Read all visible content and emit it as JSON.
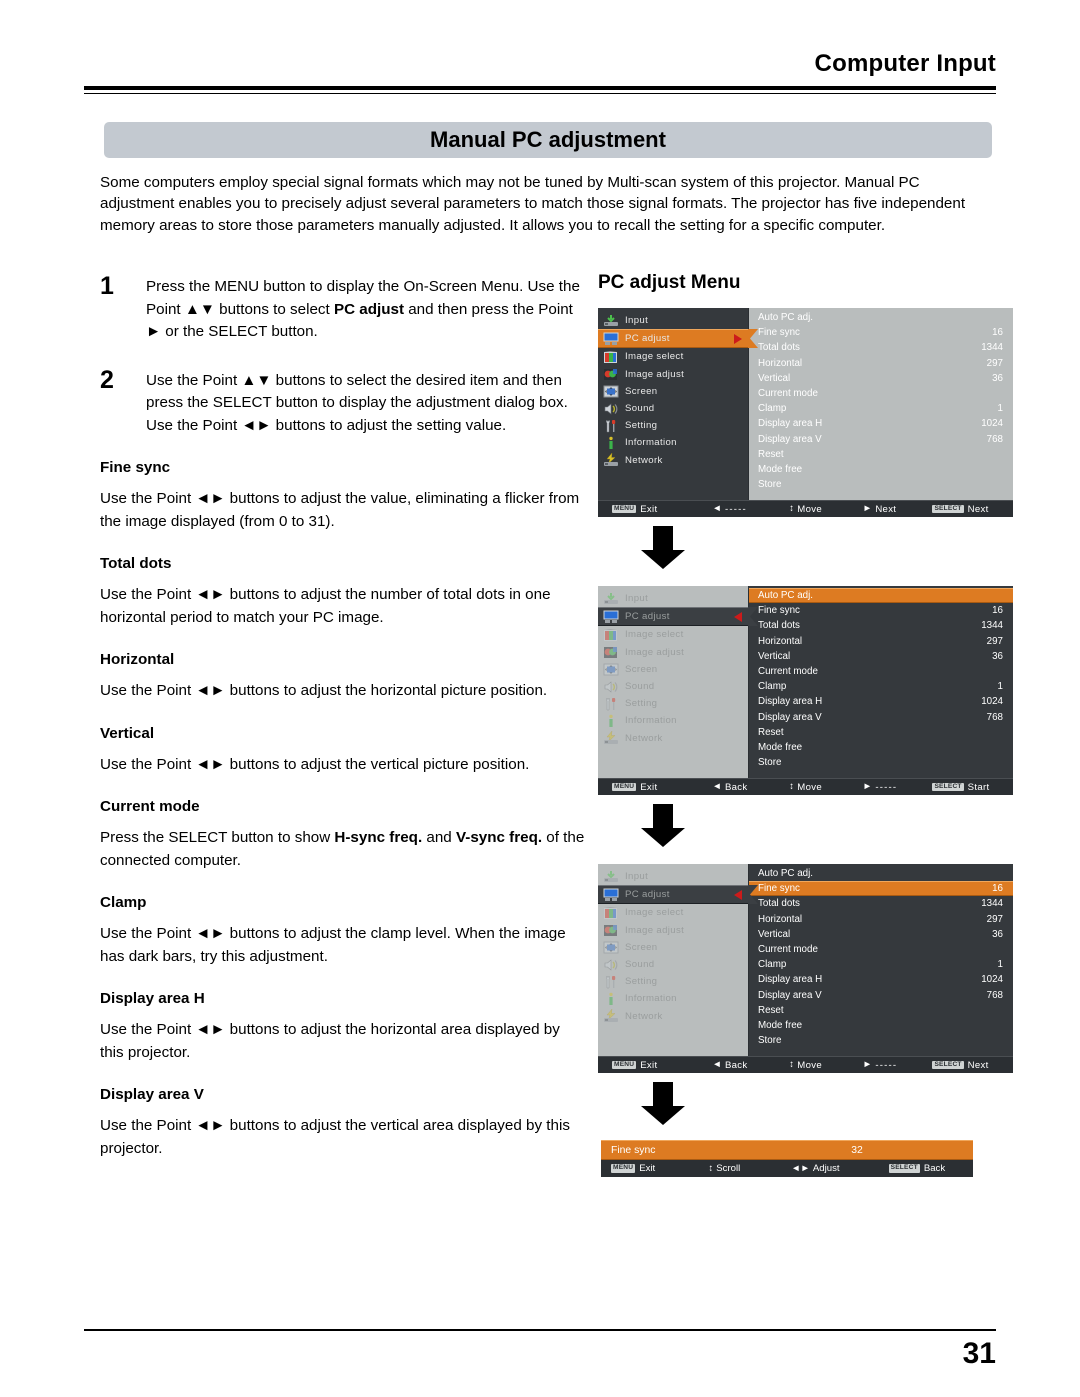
{
  "header": {
    "title": "Computer Input"
  },
  "section_title": "Manual PC adjustment",
  "intro": "Some computers employ special signal formats which may not be tuned by Multi-scan system of this projector. Manual PC adjustment enables you to precisely adjust several parameters to match those signal formats. The projector has five independent memory areas to store those parameters manually adjusted. It allows you to recall the setting for a specific computer.",
  "steps": [
    {
      "num": "1",
      "text_a": "Press the MENU button to display the On-Screen Menu. Use the Point ▲▼ buttons to select ",
      "bold": "PC adjust",
      "text_b": " and then press the Point ► or the SELECT button."
    },
    {
      "num": "2",
      "text_a": "Use the Point ▲▼ buttons to select  the desired item and then press the SELECT button to display the adjustment dialog box. Use the Point ◄► buttons to adjust the setting value.",
      "bold": "",
      "text_b": ""
    }
  ],
  "terms": [
    {
      "name": "Fine sync",
      "desc_a": "Use the Point ◄► buttons to adjust the value, eliminating a flicker from the image displayed (from 0 to 31).",
      "bold": "",
      "desc_b": ""
    },
    {
      "name": "Total dots",
      "desc_a": "Use the Point ◄► buttons to adjust the number of total dots in one horizontal period to match your PC image.",
      "bold": "",
      "desc_b": ""
    },
    {
      "name": "Horizontal",
      "desc_a": "Use the Point ◄► buttons to adjust the horizontal picture position.",
      "bold": "",
      "desc_b": ""
    },
    {
      "name": "Vertical",
      "desc_a": "Use the Point ◄► buttons to adjust the vertical picture position.",
      "bold": "",
      "desc_b": ""
    },
    {
      "name": "Current mode",
      "desc_a": "Press the SELECT button to show ",
      "bold": "H-sync freq.",
      "desc_b": " and ",
      "bold2": "V-sync freq.",
      "desc_c": " of the connected computer."
    },
    {
      "name": "Clamp",
      "desc_a": "Use the Point ◄► buttons to adjust the clamp level. When the image has dark bars, try this adjustment.",
      "bold": "",
      "desc_b": ""
    },
    {
      "name": "Display area H",
      "desc_a": "Use the Point ◄► buttons to adjust the horizontal area displayed by this projector.",
      "bold": "",
      "desc_b": ""
    },
    {
      "name": "Display area V",
      "desc_a": "Use the Point ◄► buttons to adjust the vertical area displayed by this projector.",
      "bold": "",
      "desc_b": ""
    }
  ],
  "osd": {
    "heading": "PC adjust Menu",
    "sidebar_items": [
      {
        "label": "Input",
        "icon": "input-icon"
      },
      {
        "label": "PC adjust",
        "icon": "monitor-icon"
      },
      {
        "label": "Image select",
        "icon": "image-select-icon"
      },
      {
        "label": "Image adjust",
        "icon": "image-adjust-icon"
      },
      {
        "label": "Screen",
        "icon": "screen-icon"
      },
      {
        "label": "Sound",
        "icon": "speaker-icon"
      },
      {
        "label": "Setting",
        "icon": "tools-icon"
      },
      {
        "label": "Information",
        "icon": "info-icon"
      },
      {
        "label": "Network",
        "icon": "network-icon"
      }
    ],
    "panel_items": [
      {
        "label": "Auto PC adj.",
        "value": ""
      },
      {
        "label": "Fine sync",
        "value": "16"
      },
      {
        "label": "Total dots",
        "value": "1344"
      },
      {
        "label": "Horizontal",
        "value": "297"
      },
      {
        "label": "Vertical",
        "value": "36"
      },
      {
        "label": "Current mode",
        "value": ""
      },
      {
        "label": "Clamp",
        "value": "1"
      },
      {
        "label": "Display area H",
        "value": "1024"
      },
      {
        "label": "Display area V",
        "value": "768"
      },
      {
        "label": "Reset",
        "value": ""
      },
      {
        "label": "Mode free",
        "value": ""
      },
      {
        "label": "Store",
        "value": ""
      }
    ],
    "footer_1": {
      "menu_key": "MENU",
      "exit": "Exit",
      "left_glyph": "◄",
      "left_label": "-----",
      "move_glyph": "↕",
      "move_label": "Move",
      "next_glyph": "►",
      "next_label": "Next",
      "select_key": "SELECT",
      "select_label": "Next"
    },
    "footer_2": {
      "menu_key": "MENU",
      "exit": "Exit",
      "left_glyph": "◄",
      "left_label": "Back",
      "move_glyph": "↕",
      "move_label": "Move",
      "next_glyph": "►",
      "next_label": "-----",
      "select_key": "SELECT",
      "select_label": "Start"
    },
    "footer_3": {
      "menu_key": "MENU",
      "exit": "Exit",
      "left_glyph": "◄",
      "left_label": "Back",
      "move_glyph": "↕",
      "move_label": "Move",
      "next_glyph": "►",
      "next_label": "-----",
      "select_key": "SELECT",
      "select_label": "Next"
    },
    "adjust_dialog": {
      "label": "Fine sync",
      "value": "32",
      "menu_key": "MENU",
      "exit": "Exit",
      "scroll_glyph": "↕",
      "scroll_label": "Scroll",
      "adjust_glyph": "◄►",
      "adjust_label": "Adjust",
      "select_key": "SELECT",
      "select_label": "Back"
    },
    "colors": {
      "highlight_orange": "#dd7b22",
      "panel_dark": "#35393d",
      "panel_light": "#b9bdbd",
      "footer_dark": "#2b2f33",
      "caret_red": "#cc1b1b"
    }
  },
  "page_number": "31"
}
